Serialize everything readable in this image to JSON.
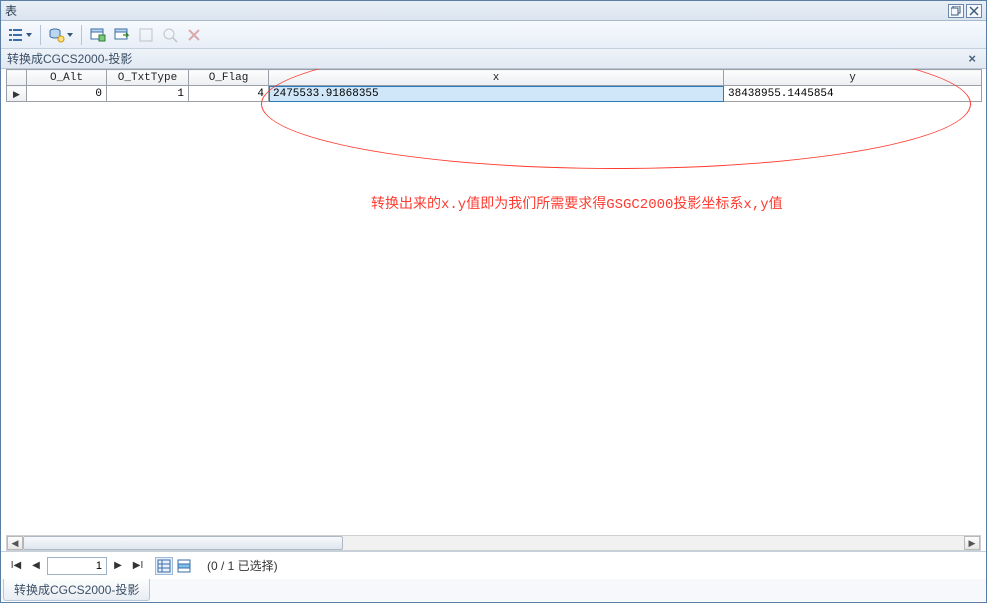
{
  "window": {
    "title": "表"
  },
  "subheader": {
    "title": "转换成CGCS2000-投影"
  },
  "columns": [
    "O_Alt",
    "O_TxtType",
    "O_Flag",
    "x",
    "y"
  ],
  "rows": [
    {
      "O_Alt": "0",
      "O_TxtType": "1",
      "O_Flag": "4",
      "x": "2475533.91868355",
      "y": "38438955.1445854"
    }
  ],
  "annotation": {
    "text": "转换出来的x.y值即为我们所需要求得GSGC2000投影坐标系x,y值"
  },
  "nav": {
    "page": "1",
    "status": "(0 / 1 已选择)"
  },
  "bottom_tab": {
    "label": "转换成CGCS2000-投影"
  }
}
